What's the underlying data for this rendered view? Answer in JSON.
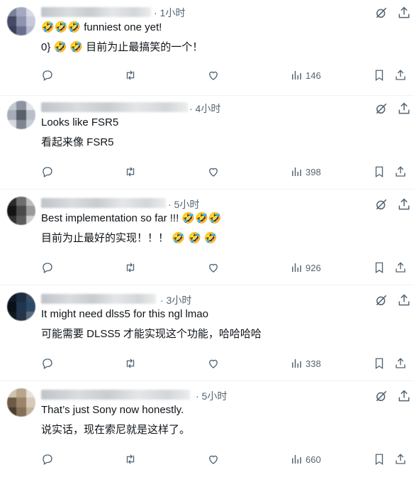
{
  "colors": {
    "icon": "#536471",
    "text": "#0f1419",
    "divider": "#eff3f4"
  },
  "tweets": [
    {
      "time": "· 1小时",
      "line1": "🤣🤣🤣 funniest one yet!",
      "line2": "0} 🤣 🤣 目前为止最搞笑的一个！",
      "views": "146"
    },
    {
      "time": "· 4小时",
      "line1": "Looks like FSR5",
      "line2": "看起来像 FSR5",
      "views": "398"
    },
    {
      "time": "· 5小时",
      "line1": "Best implementation so far !!! 🤣🤣🤣",
      "line2": "目前为止最好的实现！！！ 🤣 🤣 🤣",
      "views": "926"
    },
    {
      "time": "· 3小时",
      "line1": "It might need dlss5 for this ngl lmao",
      "line2": "可能需要 DLSS5 才能实现这个功能，哈哈哈哈",
      "views": "338"
    },
    {
      "time": "· 5小时",
      "line1": "That’s just Sony now honestly.",
      "line2": "说实话，现在索尼就是这样了。",
      "views": "660"
    }
  ],
  "icons": [
    "reply-icon",
    "retweet-icon",
    "like-icon",
    "views-icon",
    "bookmark-icon",
    "share-icon",
    "grok-icon",
    "more-icon"
  ]
}
